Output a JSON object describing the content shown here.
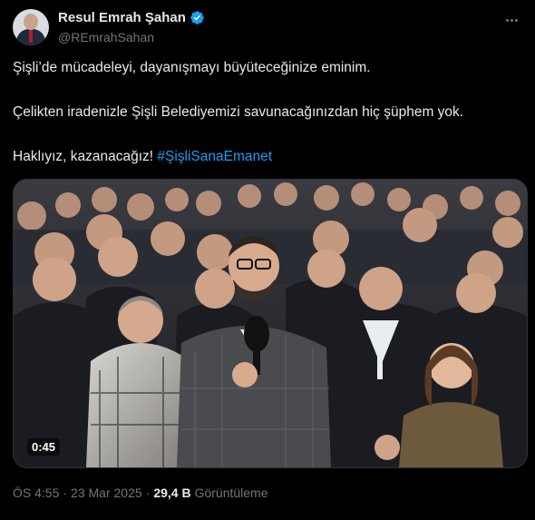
{
  "author": {
    "display_name": "Resul Emrah Şahan",
    "handle": "@REmrahSahan",
    "verified": true
  },
  "tweet": {
    "lines": [
      "Şişli’de mücadeleyi, dayanışmayı büyüteceğinize eminim.",
      "Çelikten iradenizle Şişli Belediyemizi savunacağınızdan hiç şüphem yok."
    ],
    "last_line_text": "Haklıyız, kazanacağız!",
    "hashtag": "#ŞişliSanaEmanet"
  },
  "media": {
    "duration": "0:45"
  },
  "meta": {
    "time": "ÖS 4:55",
    "separator": "·",
    "date": "23 Mar 2025",
    "views_count": "29,4 B",
    "views_label": "Görüntüleme"
  },
  "icons": {
    "verified": "verified-badge-icon",
    "more": "more-options-icon"
  },
  "colors": {
    "background": "#000000",
    "text": "#e7e9ea",
    "secondary": "#71767b",
    "accent": "#1d9bf0"
  }
}
